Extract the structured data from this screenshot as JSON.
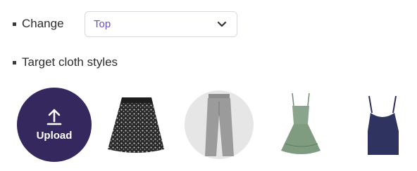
{
  "change": {
    "label": "Change",
    "selected": "Top"
  },
  "styles": {
    "label": "Target cloth styles",
    "upload_label": "Upload",
    "items": [
      {
        "name": "black floral skirt"
      },
      {
        "name": "grey jeans"
      },
      {
        "name": "green dress"
      },
      {
        "name": "navy camisole top"
      }
    ]
  },
  "colors": {
    "accent": "#6b4cc4",
    "upload_bg": "#34285f"
  }
}
